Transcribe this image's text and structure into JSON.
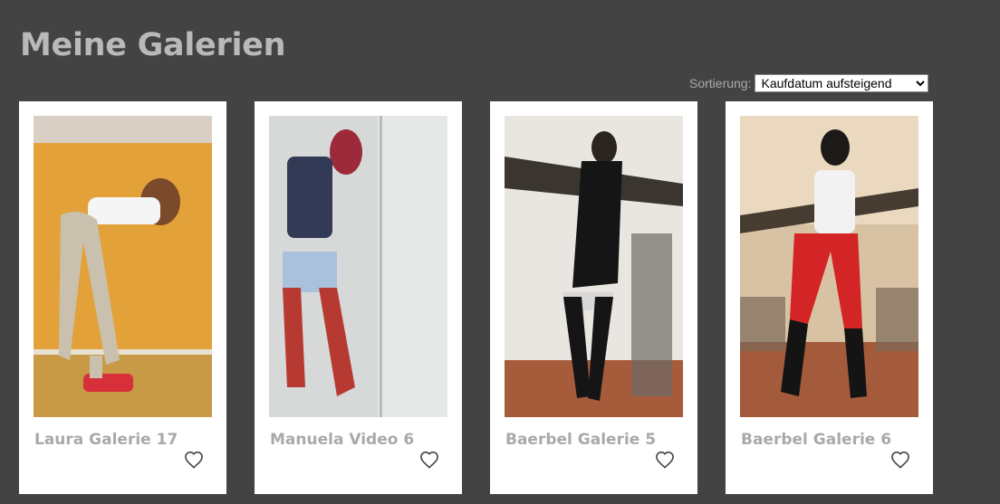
{
  "page_title": "Meine Galerien",
  "sort": {
    "label": "Sortierung:",
    "selected": "Kaufdatum aufsteigend"
  },
  "favorite_icon": "heart-outline-icon",
  "galleries": [
    {
      "title": "Laura Galerie 17",
      "image": "photo of woman in silver pants and white top bending forward against orange wall"
    },
    {
      "title": "Manuela Video 6",
      "image": "photo of woman in red thigh-high boots in a shower"
    },
    {
      "title": "Baerbel Galerie 5",
      "image": "photo of woman in black latex dress and boots in a vaulted room"
    },
    {
      "title": "Baerbel Galerie 6",
      "image": "photo of woman in red leggings and black boots in a cellar"
    }
  ]
}
